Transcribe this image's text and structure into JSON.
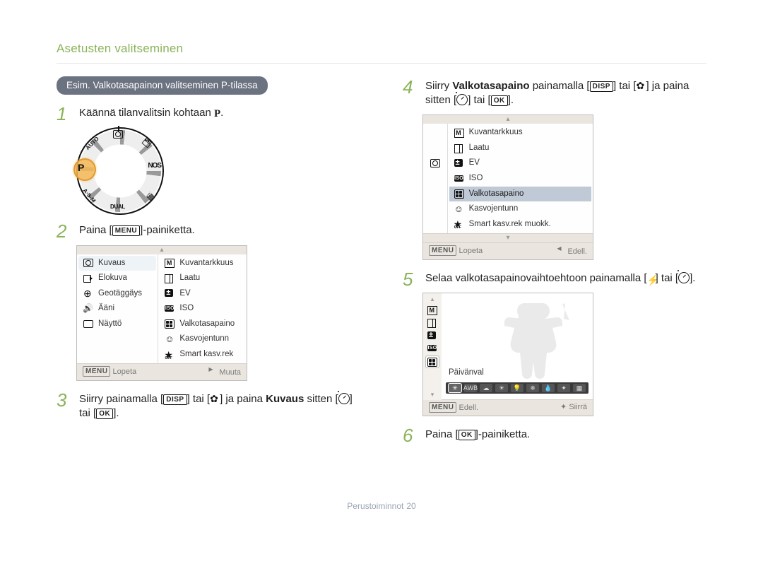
{
  "chapter_title": "Asetusten valitseminen",
  "pill_label": "Esim. Valkotasapainon valitseminen P-tilassa",
  "page_footer": {
    "label": "Perustoiminnot",
    "num": "20"
  },
  "keys": {
    "menu": "MENU",
    "ok": "OK",
    "disp": "DISP"
  },
  "modedial_P": "P",
  "steps": {
    "s1": {
      "num": "1",
      "text_a": "Käännä tilanvalitsin kohtaan ",
      "text_b": "."
    },
    "s2": {
      "num": "2",
      "text_a": "Paina [",
      "text_b": "]-painiketta."
    },
    "s3": {
      "num": "3",
      "text_a": "Siirry painamalla [",
      "text_b": "] tai [",
      "text_c": "] ja paina ",
      "bold": "Kuvaus",
      "text_d": " sitten [",
      "text_e": "] tai [",
      "text_f": "]."
    },
    "s4": {
      "num": "4",
      "text_a": "Siirry ",
      "bold": "Valkotasapaino",
      "text_b": " painamalla [",
      "text_c": "] tai [",
      "text_d": "] ja paina sitten [",
      "text_e": "] tai [",
      "text_f": "]."
    },
    "s5": {
      "num": "5",
      "text_a": "Selaa valkotasapainovaihtoehtoon painamalla [",
      "text_b": "] tai [",
      "text_c": "]."
    },
    "s6": {
      "num": "6",
      "text_a": "Paina [",
      "text_b": "]-painiketta."
    }
  },
  "screen1": {
    "left": [
      {
        "icon": "cam",
        "label": "Kuvaus",
        "selected": true
      },
      {
        "icon": "vid",
        "label": "Elokuva"
      },
      {
        "icon": "geo",
        "label": "Geotäggäys"
      },
      {
        "icon": "snd",
        "label": "Ääni"
      },
      {
        "icon": "disp",
        "label": "Näyttö"
      }
    ],
    "right": [
      {
        "icon": "size",
        "label": "Kuvantarkkuus"
      },
      {
        "icon": "qual",
        "label": "Laatu"
      },
      {
        "icon": "ev",
        "label": "EV"
      },
      {
        "icon": "iso",
        "label": "ISO"
      },
      {
        "icon": "wb",
        "label": "Valkotasapaino"
      },
      {
        "icon": "face",
        "label": "Kasvojentunn"
      },
      {
        "icon": "star",
        "label": "Smart kasv.rek"
      }
    ],
    "footer": {
      "left_key": "MENU",
      "left_lbl": "Lopeta",
      "right_icon": "caret-r",
      "right_lbl": "Muuta"
    }
  },
  "screen2": {
    "items": [
      {
        "icon": "size",
        "label": "Kuvantarkkuus"
      },
      {
        "icon": "qual",
        "label": "Laatu"
      },
      {
        "icon": "ev",
        "label": "EV"
      },
      {
        "icon": "iso",
        "label": "ISO"
      },
      {
        "icon": "wb",
        "label": "Valkotasapaino",
        "hilite": true
      },
      {
        "icon": "face",
        "label": "Kasvojentunn"
      },
      {
        "icon": "star-off",
        "label": "Smart kasv.rek muokk."
      }
    ],
    "left_sel_icon": "cam",
    "footer": {
      "left_key": "MENU",
      "left_lbl": "Lopeta",
      "right_icon": "caret-l",
      "right_lbl": "Edell."
    }
  },
  "screen3": {
    "side_icons": [
      "size",
      "qual",
      "ev",
      "iso",
      "wb"
    ],
    "side_sel_index": 4,
    "label": "Päivänval",
    "strip_icons": [
      "✳",
      "AWB",
      "☁",
      "☀",
      "💡",
      "❄",
      "💧",
      "✦",
      "▦"
    ],
    "strip_active_index": 0,
    "footer": {
      "left_key": "MENU",
      "left_lbl": "Edell.",
      "right_sym": "✦",
      "right_lbl": "Siirrä"
    }
  }
}
